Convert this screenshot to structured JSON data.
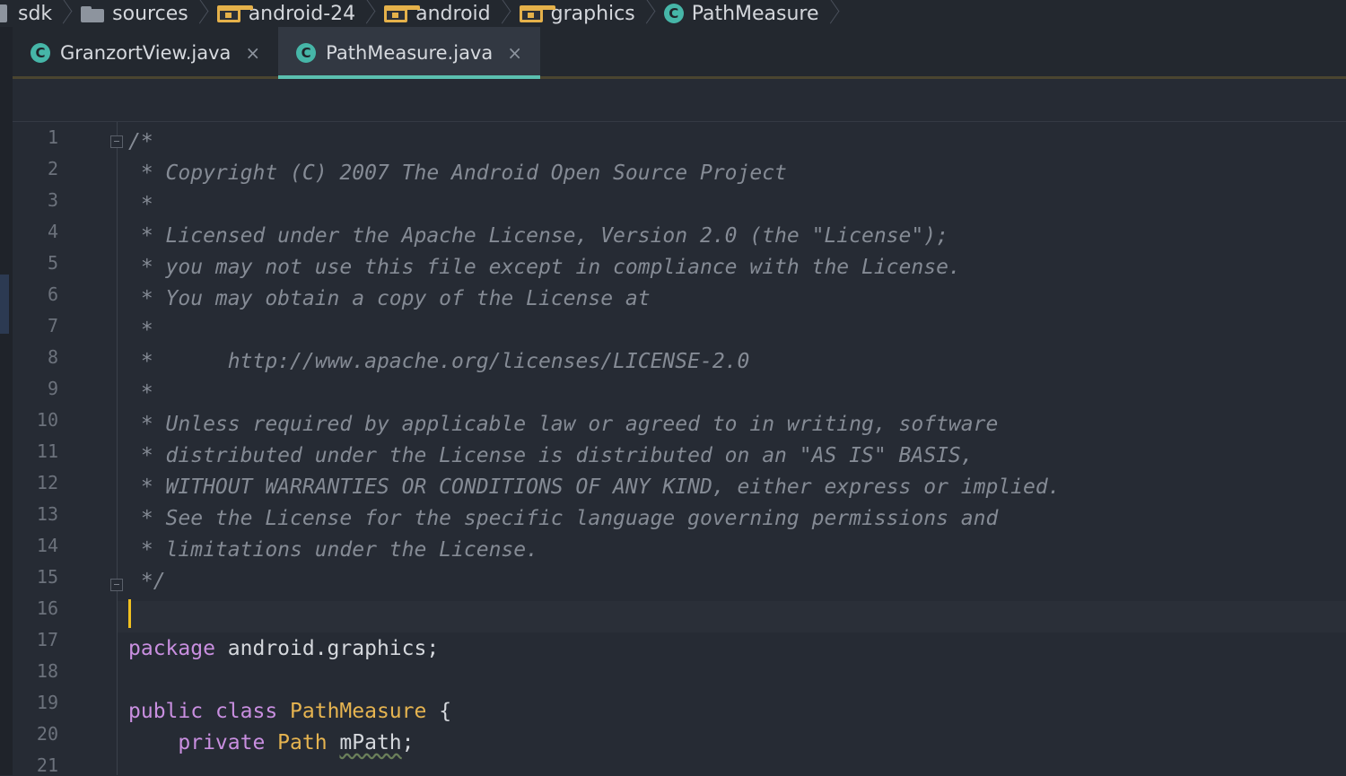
{
  "breadcrumb": {
    "items": [
      {
        "label": "sdk",
        "icon": "folder-icon"
      },
      {
        "label": "sources",
        "icon": "folder-icon"
      },
      {
        "label": "android-24",
        "icon": "package-folder-icon"
      },
      {
        "label": "android",
        "icon": "package-folder-icon"
      },
      {
        "label": "graphics",
        "icon": "package-folder-icon"
      },
      {
        "label": "PathMeasure",
        "icon": "class-icon"
      }
    ]
  },
  "tabs": [
    {
      "label": "GranzortView.java",
      "icon": "class-icon",
      "close": "×",
      "active": false
    },
    {
      "label": "PathMeasure.java",
      "icon": "class-icon",
      "close": "×",
      "active": true
    }
  ],
  "class_badge": "C",
  "editor": {
    "line_numbers": [
      "1",
      "2",
      "3",
      "4",
      "5",
      "6",
      "7",
      "8",
      "9",
      "10",
      "11",
      "12",
      "13",
      "14",
      "15",
      "16",
      "17",
      "18",
      "19",
      "20",
      "21"
    ],
    "lines": [
      "/*",
      " * Copyright (C) 2007 The Android Open Source Project",
      " *",
      " * Licensed under the Apache License, Version 2.0 (the \"License\");",
      " * you may not use this file except in compliance with the License.",
      " * You may obtain a copy of the License at",
      " *",
      " *      http://www.apache.org/licenses/LICENSE-2.0",
      " *",
      " * Unless required by applicable law or agreed to in writing, software",
      " * distributed under the License is distributed on an \"AS IS\" BASIS,",
      " * WITHOUT WARRANTIES OR CONDITIONS OF ANY KIND, either express or implied.",
      " * See the License for the specific language governing permissions and",
      " * limitations under the License.",
      " */"
    ],
    "package_kw": "package",
    "package_name": " android.graphics;",
    "class_line": {
      "public": "public",
      "class": " class ",
      "name": "PathMeasure",
      "brace": " {"
    },
    "field_line": {
      "indent": "    ",
      "private": "private",
      "type": " Path ",
      "name": "mPath",
      "semi": ";"
    }
  },
  "colors": {
    "background": "#262b34",
    "comment": "#858b95",
    "keyword": "#c98fe0",
    "class_name": "#e6b450",
    "accent": "#5bc0b0",
    "caret": "#f0c020"
  }
}
